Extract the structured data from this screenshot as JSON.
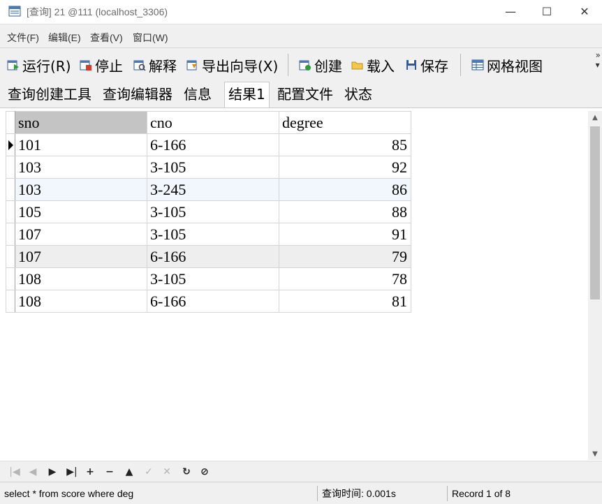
{
  "window": {
    "title": "[查询] 21 @111 (localhost_3306)",
    "minimize": "—",
    "maximize": "☐",
    "close": "✕"
  },
  "menu": [
    "文件(F)",
    "编辑(E)",
    "查看(V)",
    "窗口(W)"
  ],
  "toolbar": {
    "run": "运行(R)",
    "stop": "停止",
    "explain": "解释",
    "export": "导出向导(X)",
    "create": "创建",
    "load": "载入",
    "save": "保存",
    "grid_view": "网格视图",
    "more": "»"
  },
  "tabs": [
    "查询创建工具",
    "查询编辑器",
    "信息",
    "结果1",
    "配置文件",
    "状态"
  ],
  "active_tab": "结果1",
  "grid": {
    "columns": [
      "sno",
      "cno",
      "degree"
    ],
    "rows": [
      [
        "101",
        "6-166",
        "85"
      ],
      [
        "103",
        "3-105",
        "92"
      ],
      [
        "103",
        "3-245",
        "86"
      ],
      [
        "105",
        "3-105",
        "88"
      ],
      [
        "107",
        "3-105",
        "91"
      ],
      [
        "107",
        "6-166",
        "79"
      ],
      [
        "108",
        "3-105",
        "78"
      ],
      [
        "108",
        "6-166",
        "81"
      ]
    ]
  },
  "nav": {
    "first": "|◀",
    "prev": "◀",
    "next": "▶",
    "last": "▶|",
    "add": "+",
    "delete": "−",
    "up": "▲",
    "apply": "✓",
    "cancel": "✕",
    "refresh": "↻",
    "stop": "⊘"
  },
  "status": {
    "sql": "select * from score where  deg",
    "query_time": "查询时间: 0.001s",
    "record": "Record 1 of 8"
  },
  "colors": {
    "accent": "#2f6db5",
    "toolbar_bg": "#f0f0f0",
    "selected_header": "#c4c4c4"
  }
}
